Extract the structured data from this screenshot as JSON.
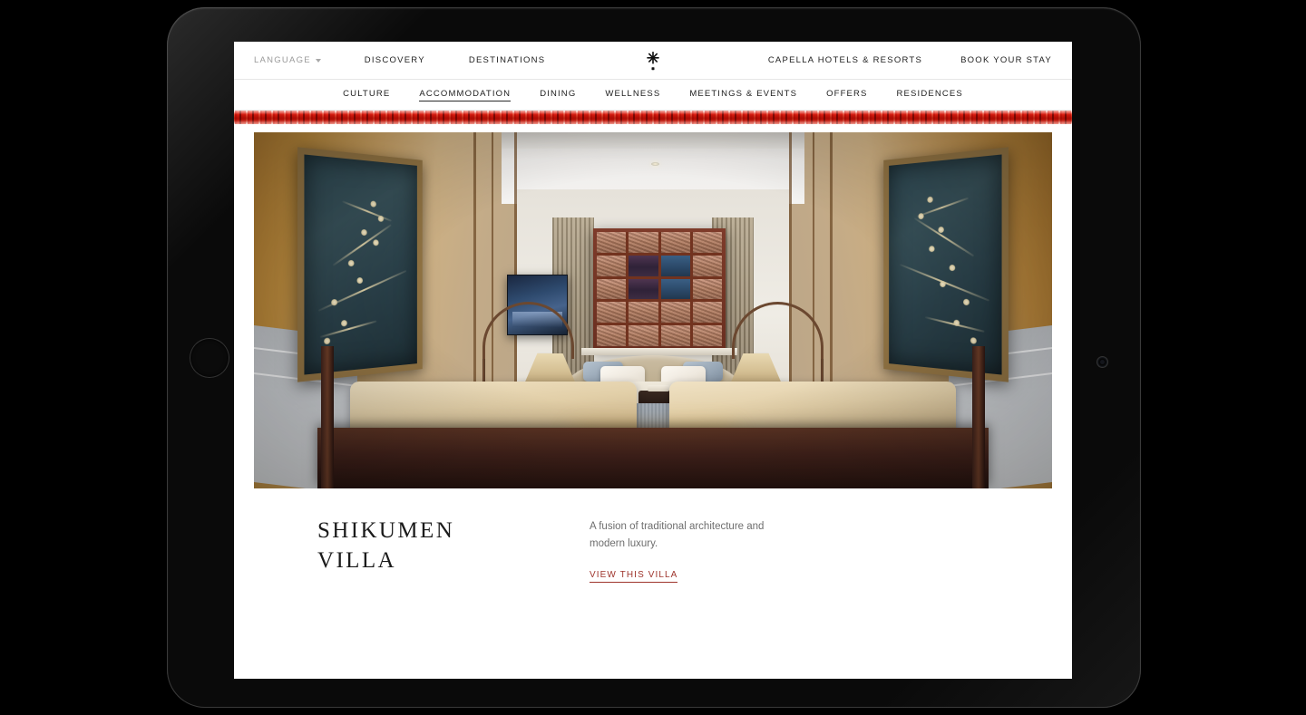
{
  "device": {
    "type": "tablet",
    "orientation": "landscape",
    "home_button": "home-button",
    "front_camera": "front-camera"
  },
  "topnav": {
    "language": {
      "label": "LANGUAGE",
      "caret": "chevron-down-icon"
    },
    "left_links": [
      {
        "label": "DISCOVERY"
      },
      {
        "label": "DESTINATIONS"
      }
    ],
    "brand_logo": "capella-star-logo",
    "right_links": [
      {
        "label": "CAPELLA HOTELS & RESORTS"
      },
      {
        "label": "BOOK YOUR STAY"
      }
    ]
  },
  "subnav": {
    "items": [
      {
        "label": "CULTURE",
        "active": false
      },
      {
        "label": "ACCOMMODATION",
        "active": true
      },
      {
        "label": "DINING",
        "active": false
      },
      {
        "label": "WELLNESS",
        "active": false
      },
      {
        "label": "MEETINGS & EVENTS",
        "active": false
      },
      {
        "label": "OFFERS",
        "active": false
      },
      {
        "label": "RESIDENCES",
        "active": false
      }
    ]
  },
  "decor_band": {
    "name": "red-wave-pattern-band",
    "color": "#c92b18"
  },
  "hero": {
    "alt": "Shikumen Villa bedroom with gold cherry blossom art panels, lattice window and arched floor lamps"
  },
  "caption": {
    "title_line1": "SHIKUMEN",
    "title_line2": "VILLA",
    "description": "A fusion of traditional architecture and modern luxury.",
    "cta_label": "VIEW THIS VILLA",
    "cta_color": "#9e342c"
  }
}
